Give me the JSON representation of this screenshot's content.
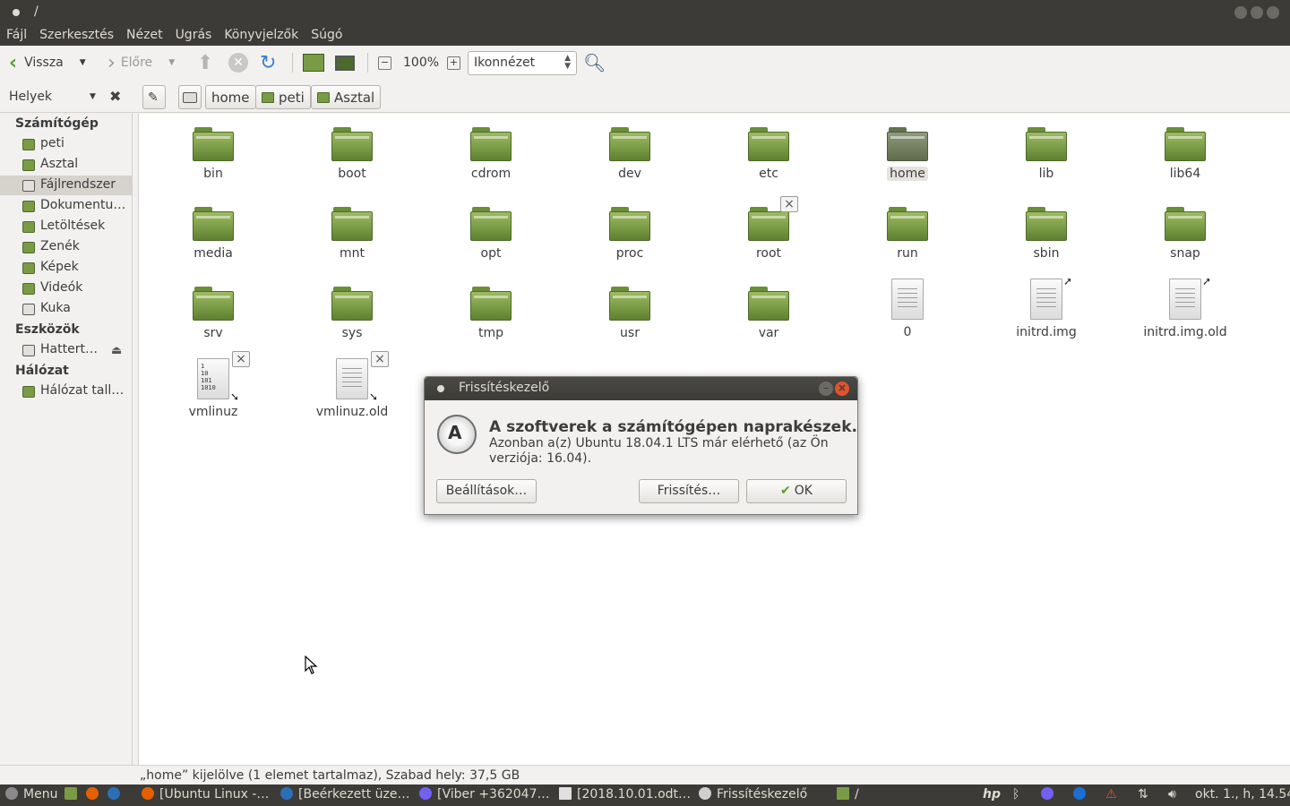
{
  "window": {
    "title": "/"
  },
  "menubar": [
    "Fájl",
    "Szerkesztés",
    "Nézet",
    "Ugrás",
    "Könyvjelzők",
    "Súgó"
  ],
  "toolbar": {
    "back": "Vissza",
    "forward": "Előre",
    "zoom": "100%",
    "view_mode": "Ikonnézet"
  },
  "location": {
    "places_label": "Helyek",
    "path": [
      "home",
      "peti",
      "Asztal"
    ]
  },
  "sidebar": {
    "sections": [
      {
        "title": "Számítógép",
        "items": [
          "peti",
          "Asztal",
          "Fájlrendszer",
          "Dokumentu…",
          "Letöltések",
          "Zenék",
          "Képek",
          "Videók",
          "Kuka"
        ]
      },
      {
        "title": "Eszközök",
        "items": [
          "Hattert…"
        ]
      },
      {
        "title": "Hálózat",
        "items": [
          "Hálózat tall…"
        ]
      }
    ],
    "selected": "Fájlrendszer"
  },
  "files": [
    {
      "name": "bin",
      "type": "folder"
    },
    {
      "name": "boot",
      "type": "folder"
    },
    {
      "name": "cdrom",
      "type": "folder"
    },
    {
      "name": "dev",
      "type": "folder"
    },
    {
      "name": "etc",
      "type": "folder"
    },
    {
      "name": "home",
      "type": "folder",
      "selected": true
    },
    {
      "name": "lib",
      "type": "folder"
    },
    {
      "name": "lib64",
      "type": "folder"
    },
    {
      "name": "media",
      "type": "folder"
    },
    {
      "name": "mnt",
      "type": "folder"
    },
    {
      "name": "opt",
      "type": "folder"
    },
    {
      "name": "proc",
      "type": "folder"
    },
    {
      "name": "root",
      "type": "folder",
      "locked": true
    },
    {
      "name": "run",
      "type": "folder"
    },
    {
      "name": "sbin",
      "type": "folder"
    },
    {
      "name": "snap",
      "type": "folder"
    },
    {
      "name": "srv",
      "type": "folder"
    },
    {
      "name": "sys",
      "type": "folder"
    },
    {
      "name": "tmp",
      "type": "folder"
    },
    {
      "name": "usr",
      "type": "folder"
    },
    {
      "name": "var",
      "type": "folder"
    },
    {
      "name": "0",
      "type": "file"
    },
    {
      "name": "initrd.img",
      "type": "link"
    },
    {
      "name": "initrd.img.old",
      "type": "link"
    },
    {
      "name": "vmlinuz",
      "type": "binary-link",
      "locked": true,
      "binary_text": [
        "1",
        "10",
        "101",
        "1010"
      ]
    },
    {
      "name": "vmlinuz.old",
      "type": "link",
      "locked": true
    }
  ],
  "status": "„home” kijelölve (1 elemet tartalmaz), Szabad hely: 37,5 GB",
  "dialog": {
    "title": "Frissítéskezelő",
    "icon_letter": "A",
    "heading": "A szoftverek a számítógépen naprakészek.",
    "message": "Azonban a(z) Ubuntu 18.04.1 LTS már elérhető (az Ön verziója: 16.04).",
    "settings_button": "Beállítások…",
    "update_button": "Frissítés…",
    "ok_button": "OK"
  },
  "taskbar": {
    "menu": "Menu",
    "tasks": [
      "[Ubuntu Linux -…",
      "[Beérkezett üze…",
      "[Viber +362047…",
      "[2018.10.01.odt…",
      "Frissítéskezelő",
      "/"
    ],
    "clock": "okt. 1., h, 14.54"
  },
  "colors": {
    "folder": "#7a9b45",
    "titlebar": "#3c3b37",
    "close": "#e2532c"
  }
}
